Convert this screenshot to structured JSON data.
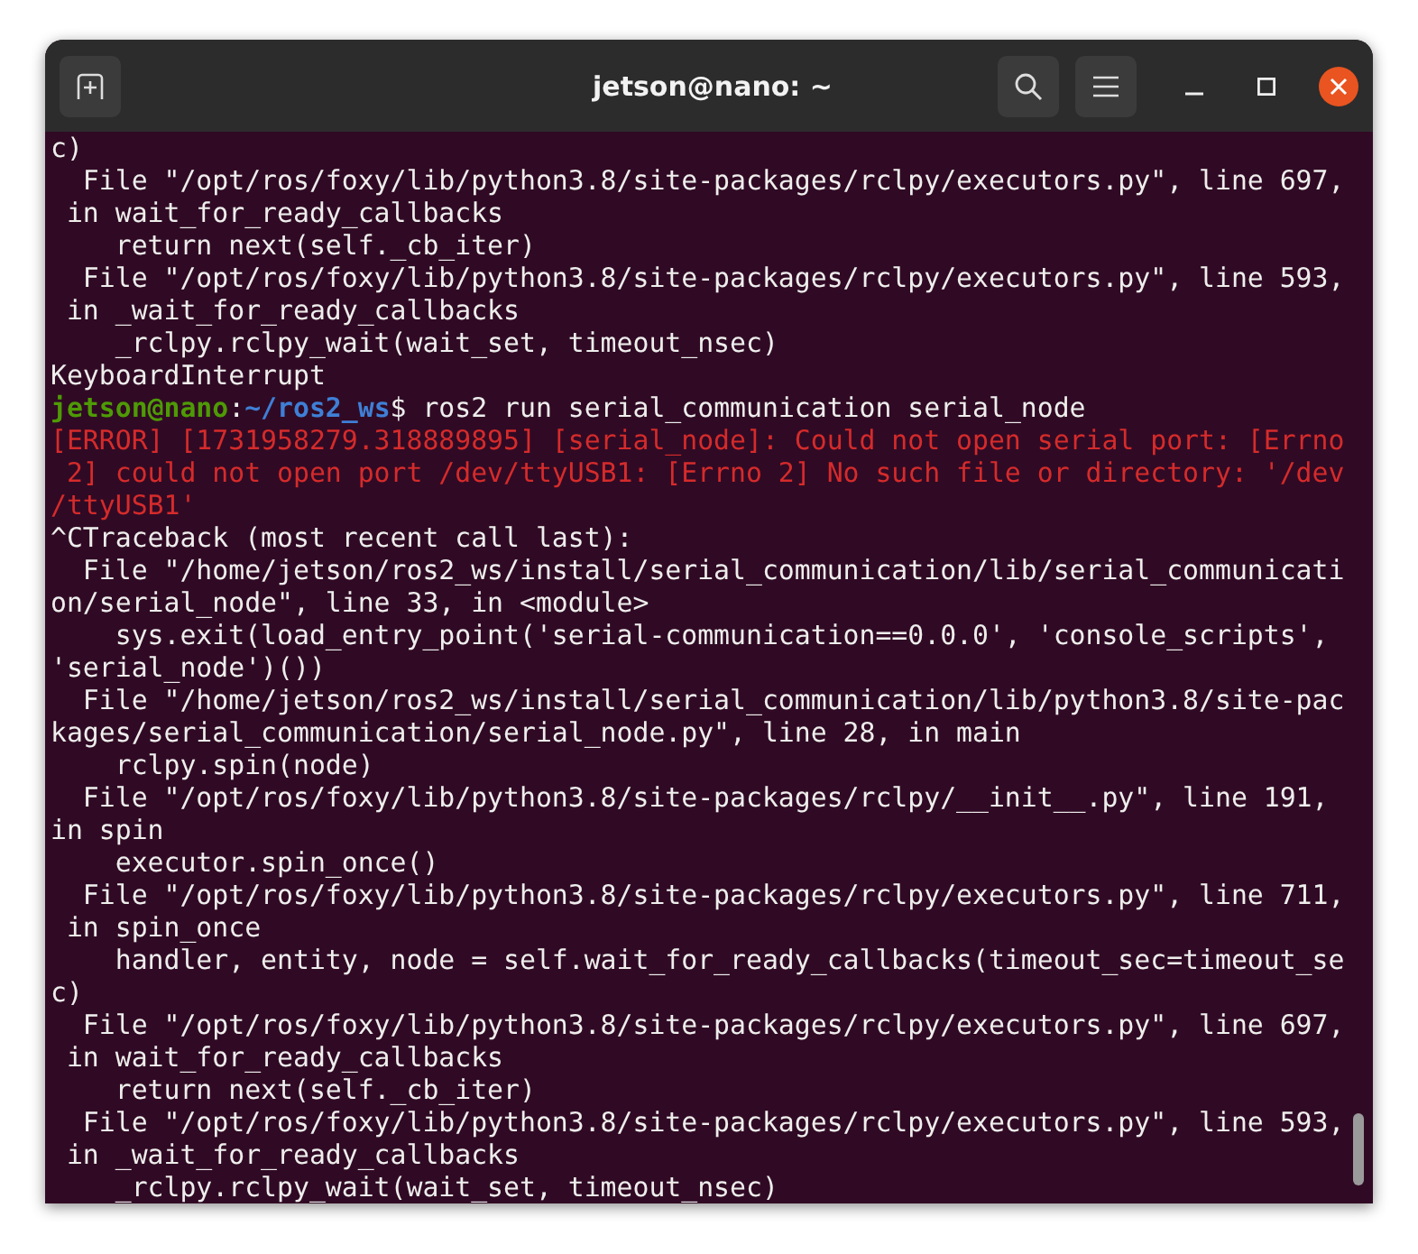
{
  "window": {
    "title": "jetson@nano: ~"
  },
  "terminal": {
    "lines": [
      {
        "kind": "output",
        "text": "c)"
      },
      {
        "kind": "output",
        "text": "  File \"/opt/ros/foxy/lib/python3.8/site-packages/rclpy/executors.py\", line 697,"
      },
      {
        "kind": "output",
        "text": " in wait_for_ready_callbacks"
      },
      {
        "kind": "output",
        "text": "    return next(self._cb_iter)"
      },
      {
        "kind": "output",
        "text": "  File \"/opt/ros/foxy/lib/python3.8/site-packages/rclpy/executors.py\", line 593,"
      },
      {
        "kind": "output",
        "text": " in _wait_for_ready_callbacks"
      },
      {
        "kind": "output",
        "text": "    _rclpy.rclpy_wait(wait_set, timeout_nsec)"
      },
      {
        "kind": "output",
        "text": "KeyboardInterrupt"
      },
      {
        "kind": "prompt",
        "user": "jetson@nano",
        "sep": ":",
        "path": "~/ros2_ws",
        "command": "$ ros2 run serial_communication serial_node"
      },
      {
        "kind": "error",
        "text": "[ERROR] [1731958279.318889895] [serial_node]: Could not open serial port: [Errno"
      },
      {
        "kind": "error",
        "text": " 2] could not open port /dev/ttyUSB1: [Errno 2] No such file or directory: '/dev"
      },
      {
        "kind": "error",
        "text": "/ttyUSB1'"
      },
      {
        "kind": "output",
        "text": "^CTraceback (most recent call last):"
      },
      {
        "kind": "output",
        "text": "  File \"/home/jetson/ros2_ws/install/serial_communication/lib/serial_communicati"
      },
      {
        "kind": "output",
        "text": "on/serial_node\", line 33, in <module>"
      },
      {
        "kind": "output",
        "text": "    sys.exit(load_entry_point('serial-communication==0.0.0', 'console_scripts',"
      },
      {
        "kind": "output",
        "text": "'serial_node')())"
      },
      {
        "kind": "output",
        "text": "  File \"/home/jetson/ros2_ws/install/serial_communication/lib/python3.8/site-pac"
      },
      {
        "kind": "output",
        "text": "kages/serial_communication/serial_node.py\", line 28, in main"
      },
      {
        "kind": "output",
        "text": "    rclpy.spin(node)"
      },
      {
        "kind": "output",
        "text": "  File \"/opt/ros/foxy/lib/python3.8/site-packages/rclpy/__init__.py\", line 191,"
      },
      {
        "kind": "output",
        "text": "in spin"
      },
      {
        "kind": "output",
        "text": "    executor.spin_once()"
      },
      {
        "kind": "output",
        "text": "  File \"/opt/ros/foxy/lib/python3.8/site-packages/rclpy/executors.py\", line 711,"
      },
      {
        "kind": "output",
        "text": " in spin_once"
      },
      {
        "kind": "output",
        "text": "    handler, entity, node = self.wait_for_ready_callbacks(timeout_sec=timeout_se"
      },
      {
        "kind": "output",
        "text": "c)"
      },
      {
        "kind": "output",
        "text": "  File \"/opt/ros/foxy/lib/python3.8/site-packages/rclpy/executors.py\", line 697,"
      },
      {
        "kind": "output",
        "text": " in wait_for_ready_callbacks"
      },
      {
        "kind": "output",
        "text": "    return next(self._cb_iter)"
      },
      {
        "kind": "output",
        "text": "  File \"/opt/ros/foxy/lib/python3.8/site-packages/rclpy/executors.py\", line 593,"
      },
      {
        "kind": "output",
        "text": " in _wait_for_ready_callbacks"
      },
      {
        "kind": "output",
        "text": "    _rclpy.rclpy_wait(wait_set, timeout_nsec)"
      }
    ]
  }
}
